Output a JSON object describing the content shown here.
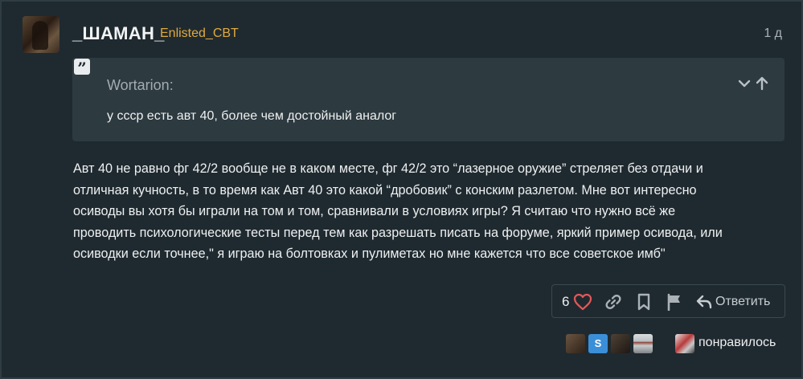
{
  "post": {
    "username": "_ШАМАН_",
    "user_group": "Enlisted_CBT",
    "date": "1 д",
    "quote": {
      "icon": "quote-icon",
      "icon_glyph": "”",
      "author": "Wortarion:",
      "text": "у ссср есть авт 40, более чем достойный аналог"
    },
    "body_lines": [
      "Авт 40 не равно фг 42/2 вообще не в каком месте, фг 42/2 это “лазерное оружие” стреляет без отдачи и",
      "отличная кучность, в то время как Авт 40 это какой “дробовик” с конским разлетом. Мне вот интересно",
      "осиводы вы хотя бы играли на том и том, сравнивали в условиях игры? Я считаю что нужно всё же",
      "проводить психологические тесты перед тем как разрешать писать на форуме, яркий пример осивода, или",
      "осиводки если точнее,\" я играю на болтовках и пулиметах но мне кажется что все советское имб\""
    ],
    "actions": {
      "like_count": "6",
      "reply_label": "Ответить"
    },
    "liked_by": {
      "label": "понравилось",
      "second_avatar_letter": "S"
    }
  },
  "colors": {
    "background": "#1f2a30",
    "quote_background": "#2d3a40",
    "user_group": "#e0a93f",
    "heart": "#e45858"
  }
}
